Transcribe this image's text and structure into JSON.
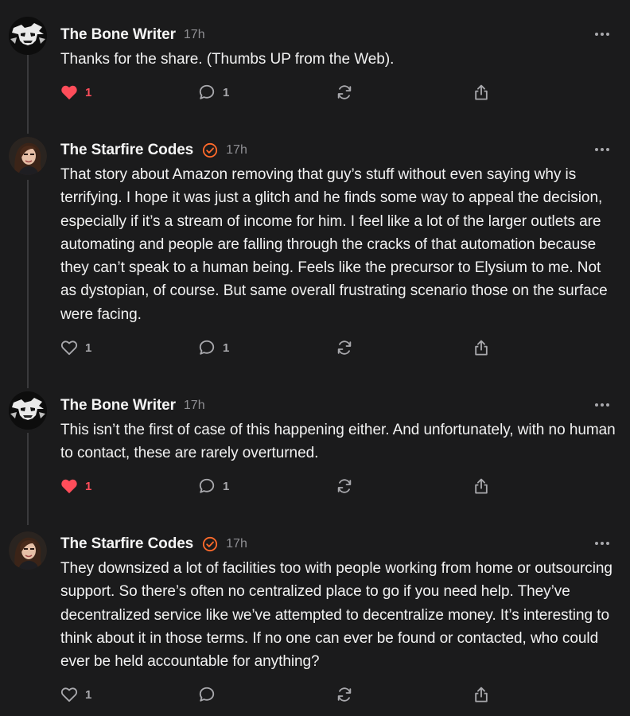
{
  "posts": [
    {
      "author": "The Bone Writer",
      "time": "17h",
      "verified": false,
      "avatar": "bone-writer",
      "text": "Thanks for the share. (Thumbs UP from the Web).",
      "likes": "1",
      "liked": true,
      "replies": "1"
    },
    {
      "author": "The Starfire Codes",
      "time": "17h",
      "verified": true,
      "avatar": "starfire",
      "text": "That story about Amazon removing that guy’s stuff without even saying why is terrifying. I hope it was just a glitch and he finds some way to appeal the decision, especially if it’s a stream of income for him. I feel like a lot of the larger outlets are automating and people are falling through the cracks of that automation because they can’t speak to a human being. Feels like the precursor to Elysium to me. Not as dystopian, of course. But same overall frustrating scenario those on the surface were facing.",
      "likes": "1",
      "liked": false,
      "replies": "1"
    },
    {
      "author": "The Bone Writer",
      "time": "17h",
      "verified": false,
      "avatar": "bone-writer",
      "text": "This isn’t the first of case of this happening either. And unfortunately, with no human to contact, these are rarely overturned.",
      "likes": "1",
      "liked": true,
      "replies": "1"
    },
    {
      "author": "The Starfire Codes",
      "time": "17h",
      "verified": true,
      "avatar": "starfire",
      "text": "They downsized a lot of facilities too with people working from home or outsourcing support. So there’s often no centralized place to go if you need help. They’ve decentralized service like we’ve attempted to decentralize money. It’s interesting to think about it in those terms. If no one can ever be found or contacted, who could ever be held accountable for anything?",
      "likes": "1",
      "liked": false,
      "replies": ""
    }
  ],
  "icons": {
    "like": "heart-icon",
    "reply": "comment-icon",
    "repost": "repost-icon",
    "share": "share-icon",
    "more": "more-options-icon",
    "verified": "verified-badge-icon"
  },
  "colors": {
    "background": "#1b1b1c",
    "liked": "#ff4d5a",
    "verified": "#ff6a2b",
    "muted": "#8e8e92"
  }
}
